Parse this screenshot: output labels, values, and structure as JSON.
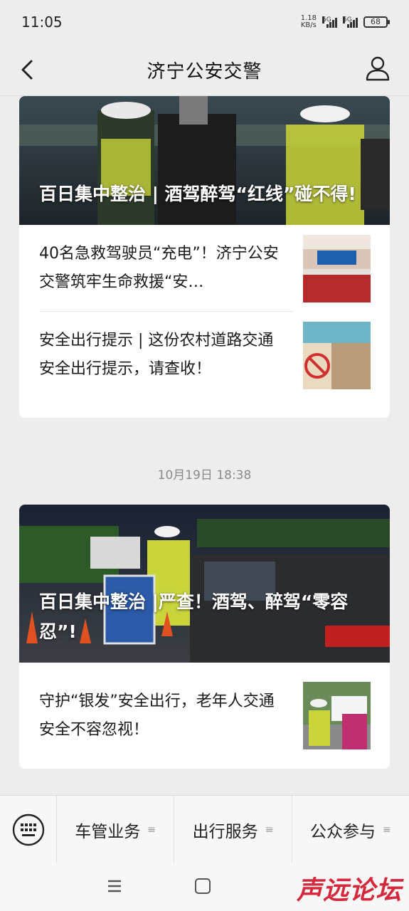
{
  "status_bar": {
    "time": "11:05",
    "net_speed_value": "1.18",
    "net_speed_unit": "KB/s",
    "signal_1": "5G",
    "signal_2": "5G",
    "battery": "68"
  },
  "header": {
    "title": "济宁公安交警",
    "back_icon": "chevron-left-icon",
    "profile_icon": "person-icon"
  },
  "feed": {
    "group1": {
      "cover_title": "百日集中整治 | 酒驾醉驾“红线”碰不得!",
      "items": [
        {
          "text": "40名急救驾驶员“充电”！济宁公安交警筑牢生命救援“安…"
        },
        {
          "text": "安全出行提示 | 这份农村道路交通安全出行提示，请查收！"
        }
      ]
    },
    "timestamp": "10月19日 18:38",
    "group2": {
      "cover_title": "百日集中整治 |严查！酒驾、醉驾“零容忍”!",
      "items": [
        {
          "text": "守护“银发”安全出行，老年人交通安全不容忽视！"
        }
      ]
    }
  },
  "bottom_menu": {
    "keyboard_icon": "keyboard-icon",
    "items": [
      {
        "label": "车管业务",
        "glyph": "≡"
      },
      {
        "label": "出行服务",
        "glyph": "≡"
      },
      {
        "label": "公众参与",
        "glyph": "≡"
      }
    ]
  },
  "system_nav": {
    "watermark": "声远论坛"
  },
  "colors": {
    "background": "#ededed",
    "card": "#ffffff",
    "watermark": "#d4283c"
  }
}
